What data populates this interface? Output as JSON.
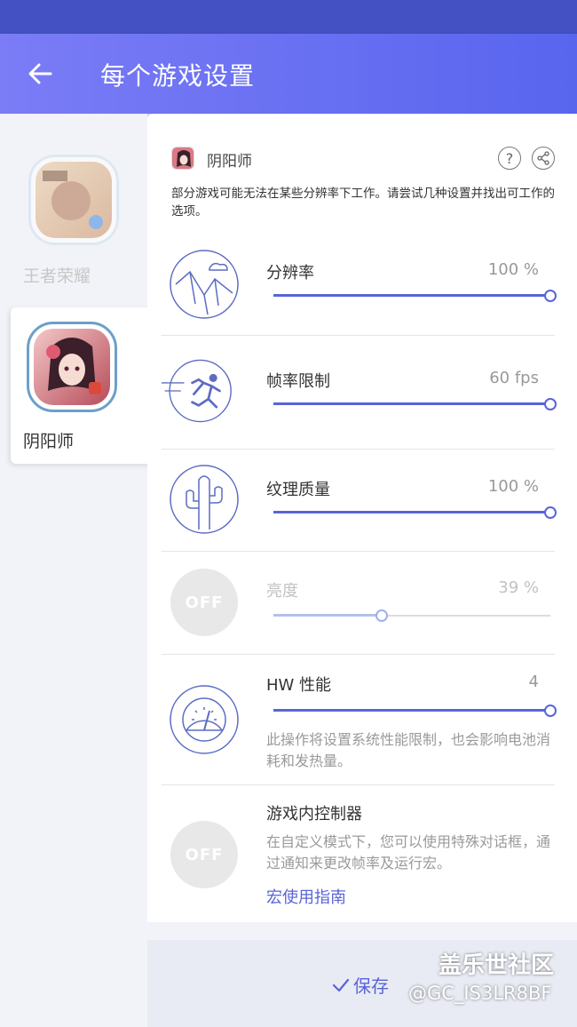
{
  "app_bar": {
    "title": "每个游戏设置"
  },
  "games": [
    {
      "label": "王者荣耀",
      "selected": false
    },
    {
      "label": "阴阳师",
      "selected": true
    }
  ],
  "header": {
    "game_name": "阴阳师",
    "help_icon": "question-circle-icon",
    "share_icon": "share-icon"
  },
  "notice": "部分游戏可能无法在某些分辨率下工作。请尝试几种设置并找出可工作的选项。",
  "settings": {
    "resolution": {
      "label": "分辨率",
      "value": "100 %",
      "level": 1.0,
      "icon": "mountains-sun-icon"
    },
    "frame_rate": {
      "label": "帧率限制",
      "value": "60 fps",
      "level": 1.0,
      "icon": "running-man-icon"
    },
    "texture": {
      "label": "纹理质量",
      "value": "100 %",
      "level": 1.0,
      "icon": "cactus-icon"
    },
    "brightness": {
      "label": "亮度",
      "value": "39 %",
      "level": 0.39,
      "toggle": "OFF",
      "icon": "sun-off-icon"
    },
    "hw_perf": {
      "label": "HW 性能",
      "value": "4",
      "level": 1.0,
      "icon": "speedometer-icon",
      "desc": "此操作将设置系统性能限制，也会影响电池消耗和发热量。"
    },
    "in_game_controller": {
      "label": "游戏内控制器",
      "toggle": "OFF",
      "icon": "chat-bubble-off-icon",
      "desc": "在自定义模式下，您可以使用特殊对话框，通过通知来更改帧率及运行宏。",
      "link": "宏使用指南"
    }
  },
  "bottom": {
    "save_label": "保存",
    "save_icon": "checkmark-icon"
  },
  "watermark": {
    "title": "盖乐世社区",
    "user": "@GC_IS3LR8BF"
  },
  "colors": {
    "accent": "#5865d6",
    "app_bar_start": "#7b7cf6",
    "app_bar_end": "#5865ee",
    "status_bar": "#4451c2"
  }
}
